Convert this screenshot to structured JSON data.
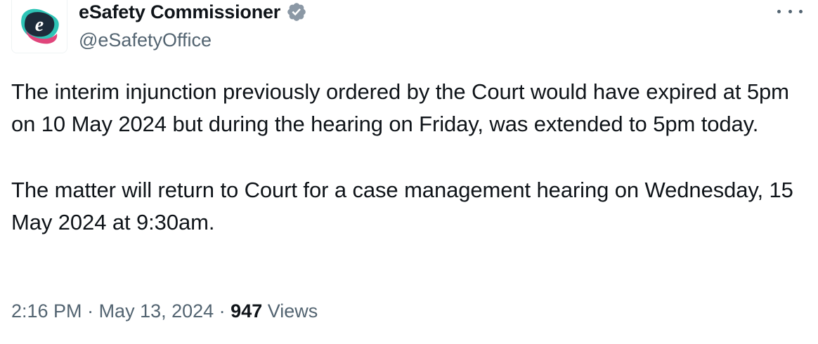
{
  "author": {
    "display_name": "eSafety Commissioner",
    "handle": "@eSafetyOffice",
    "avatar_icon": "esafety-logo-icon",
    "verified_icon": "verified-badge-icon"
  },
  "tweet": {
    "paragraphs": [
      "The interim injunction previously ordered by the Court would have expired at 5pm on 10 May 2024 but during the hearing on Friday, was extended to 5pm today.",
      "The matter will return to Court for a case management hearing on Wednesday, 15 May 2024 at 9:30am."
    ]
  },
  "meta": {
    "time": "2:16 PM",
    "separator": " · ",
    "date": "May 13, 2024",
    "views_count": "947",
    "views_label": "Views"
  },
  "more_icon": "more-options-icon",
  "colors": {
    "text": "#0f1419",
    "secondary": "#536471",
    "logo_dark": "#1d2b3a",
    "logo_teal": "#2ec4b6",
    "logo_magenta": "#e0457b",
    "verified": "#8b98a5"
  }
}
